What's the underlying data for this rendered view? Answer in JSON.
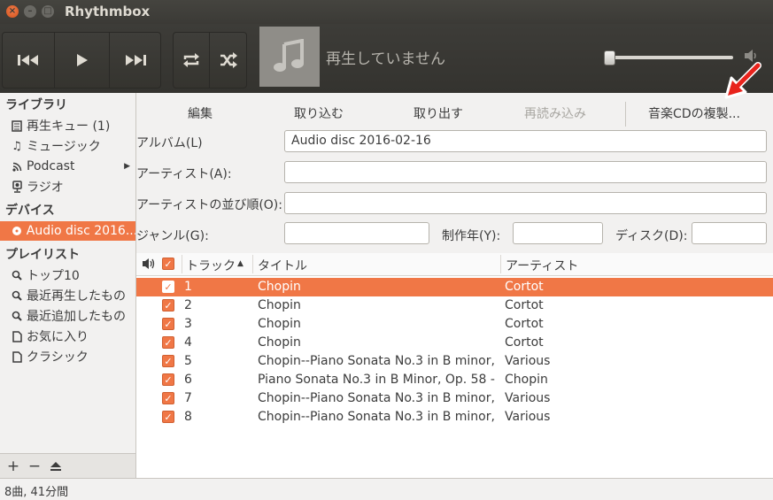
{
  "window": {
    "title": "Rhythmbox"
  },
  "player": {
    "now_playing": "再生していません"
  },
  "sidebar": {
    "library_heading": "ライブラリ",
    "library": [
      {
        "label": "再生キュー (1)",
        "icon": "queue-icon"
      },
      {
        "label": "ミュージック",
        "icon": "music-note-icon"
      },
      {
        "label": "Podcast",
        "icon": "rss-icon"
      },
      {
        "label": "ラジオ",
        "icon": "radio-icon"
      }
    ],
    "devices_heading": "デバイス",
    "devices": [
      {
        "label": "Audio disc 2016...",
        "icon": "cd-icon",
        "selected": true
      }
    ],
    "playlists_heading": "プレイリスト",
    "playlists": [
      {
        "label": "トップ10",
        "icon": "search-icon"
      },
      {
        "label": "最近再生したもの",
        "icon": "search-icon"
      },
      {
        "label": "最近追加したもの",
        "icon": "search-icon"
      },
      {
        "label": "お気に入り",
        "icon": "document-icon"
      },
      {
        "label": "クラシック",
        "icon": "document-icon"
      }
    ]
  },
  "actions": {
    "edit": "編集",
    "import": "取り込む",
    "eject": "取り出す",
    "reload": "再読み込み",
    "copy_cd": "音楽CDの複製..."
  },
  "form": {
    "album_label": "アルバム(L)",
    "album_value": "Audio disc 2016-02-16",
    "artist_label": "アーティスト(A):",
    "artist_value": "",
    "artist_sort_label": "アーティストの並び順(O):",
    "artist_sort_value": "",
    "genre_label": "ジャンル(G):",
    "genre_value": "",
    "year_label": "制作年(Y):",
    "year_value": "",
    "disc_label": "ディスク(D):",
    "disc_value": ""
  },
  "tracklist": {
    "columns": {
      "track": "トラック",
      "title": "タイトル",
      "artist": "アーティスト"
    },
    "rows": [
      {
        "track": "1",
        "title": "Chopin",
        "artist": "Cortot",
        "selected": true
      },
      {
        "track": "2",
        "title": "Chopin",
        "artist": "Cortot"
      },
      {
        "track": "3",
        "title": "Chopin",
        "artist": "Cortot"
      },
      {
        "track": "4",
        "title": "Chopin",
        "artist": "Cortot"
      },
      {
        "track": "5",
        "title": "Chopin--Piano Sonata No.3 in B minor, ...",
        "artist": "Various"
      },
      {
        "track": "6",
        "title": "Piano Sonata No.3 in B Minor, Op. 58 - ...",
        "artist": "Chopin"
      },
      {
        "track": "7",
        "title": "Chopin--Piano Sonata No.3 in B minor, ...",
        "artist": "Various"
      },
      {
        "track": "8",
        "title": "Chopin--Piano Sonata No.3 in B minor, ...",
        "artist": "Various"
      }
    ]
  },
  "status": {
    "text": "8曲, 41分間"
  },
  "colors": {
    "accent": "#f07746",
    "toolbar": "#3c3b37",
    "annotation_arrow": "#e8231c"
  }
}
